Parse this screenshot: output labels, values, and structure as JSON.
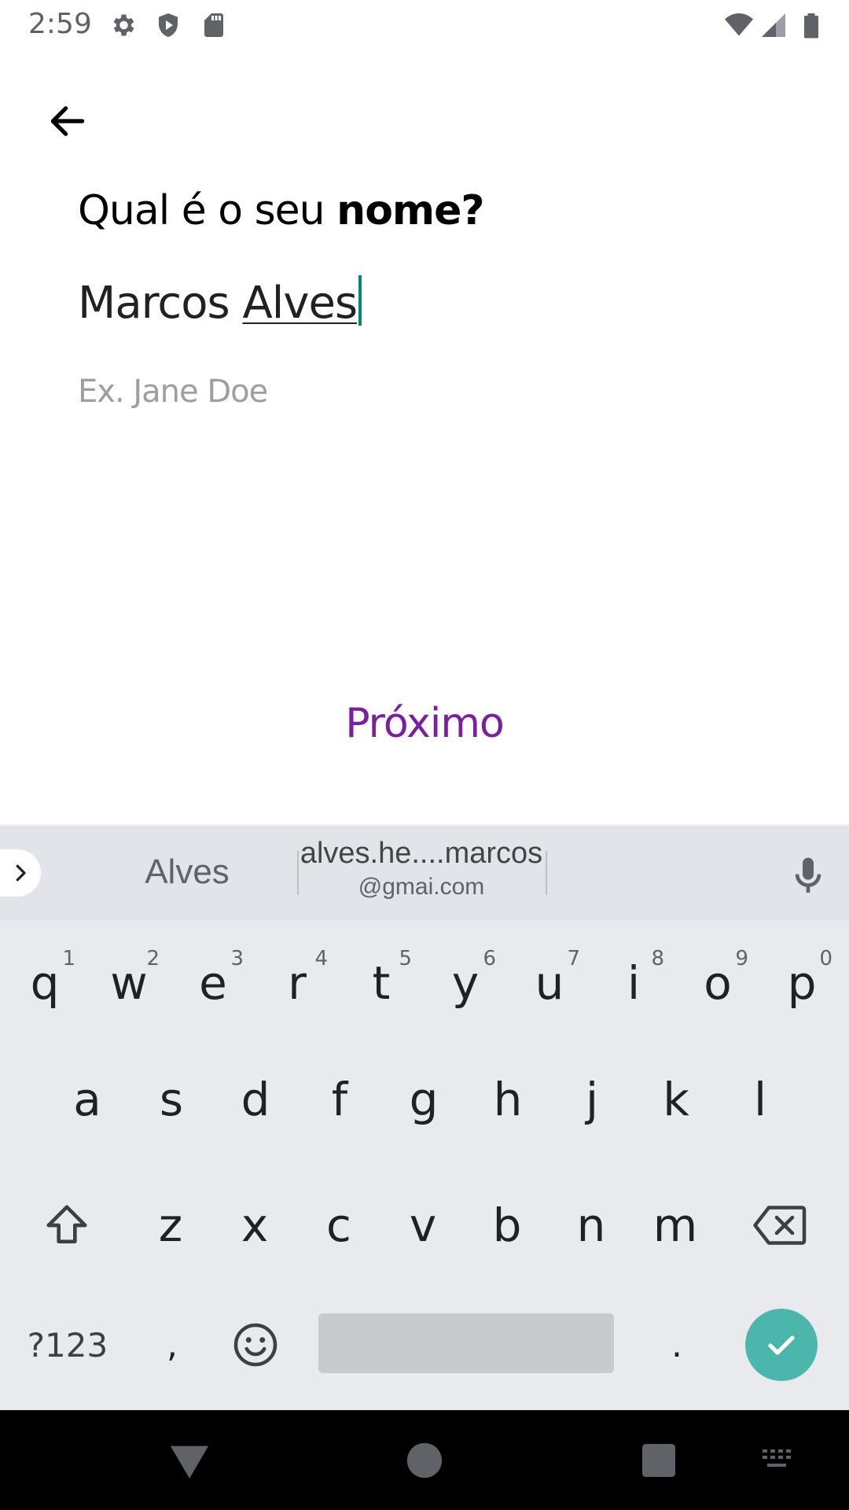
{
  "status_bar": {
    "time": "2:59",
    "icons": [
      "settings-icon",
      "shield-icon",
      "sd-card-icon",
      "wifi-icon",
      "signal-icon",
      "battery-icon"
    ]
  },
  "screen": {
    "title_regular": "Qual é o seu ",
    "title_bold": "nome?",
    "name_first": "Marcos ",
    "name_last": "Alves",
    "hint": "Ex. Jane Doe",
    "next_label": "Próximo",
    "accent_color": "#7b1fa2"
  },
  "keyboard": {
    "suggestions": {
      "first": "Alves",
      "second_line1": "alves.he....marcos",
      "second_line2": "@gmai.com"
    },
    "rows": [
      [
        {
          "k": "q",
          "h": "1"
        },
        {
          "k": "w",
          "h": "2"
        },
        {
          "k": "e",
          "h": "3"
        },
        {
          "k": "r",
          "h": "4"
        },
        {
          "k": "t",
          "h": "5"
        },
        {
          "k": "y",
          "h": "6"
        },
        {
          "k": "u",
          "h": "7"
        },
        {
          "k": "i",
          "h": "8"
        },
        {
          "k": "o",
          "h": "9"
        },
        {
          "k": "p",
          "h": "0"
        }
      ],
      [
        {
          "k": "a"
        },
        {
          "k": "s"
        },
        {
          "k": "d"
        },
        {
          "k": "f"
        },
        {
          "k": "g"
        },
        {
          "k": "h"
        },
        {
          "k": "j"
        },
        {
          "k": "k"
        },
        {
          "k": "l"
        }
      ],
      [
        {
          "k": "z"
        },
        {
          "k": "x"
        },
        {
          "k": "c"
        },
        {
          "k": "v"
        },
        {
          "k": "b"
        },
        {
          "k": "n"
        },
        {
          "k": "m"
        }
      ]
    ],
    "symbols_label": "?123",
    "comma": ",",
    "period": ".",
    "enter_color": "#4db6ac"
  },
  "nav_bar": {
    "buttons": [
      "back-triangle-icon",
      "home-circle-icon",
      "recents-square-icon",
      "keyboard-switch-icon"
    ]
  }
}
